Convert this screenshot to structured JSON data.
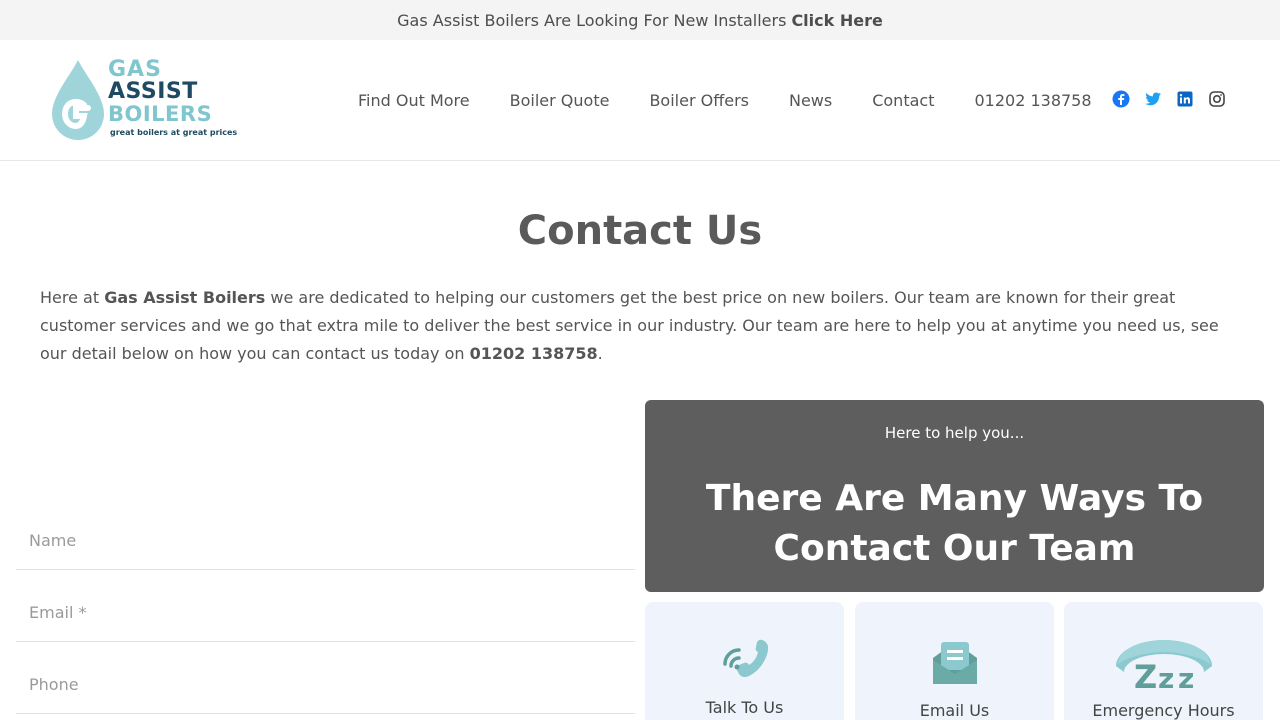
{
  "topbar": {
    "text": "Gas Assist Boilers Are Looking For New Installers",
    "link": "Click Here"
  },
  "logo": {
    "line1": "GAS",
    "line2": "ASSIST",
    "line3": "BOILERS",
    "tagline": "great boilers at great prices"
  },
  "nav": {
    "items": [
      {
        "label": "Find Out More"
      },
      {
        "label": "Boiler Quote"
      },
      {
        "label": "Boiler Offers"
      },
      {
        "label": "News"
      },
      {
        "label": "Contact"
      },
      {
        "label": "01202 138758"
      }
    ],
    "social": [
      "facebook-icon",
      "twitter-icon",
      "linkedin-icon",
      "instagram-icon"
    ]
  },
  "page": {
    "title": "Contact Us",
    "intro_before": "Here at ",
    "intro_brand": "Gas Assist Boilers",
    "intro_middle": " we are dedicated to helping our customers get the best price on new boilers. Our team are known for their great customer services and we go that extra mile to deliver the best service in our industry. Our team are here to help you at anytime you need us, see our detail below on how you can contact us today on ",
    "intro_phone": "01202 138758",
    "intro_end": "."
  },
  "form": {
    "name_placeholder": "Name",
    "email_placeholder": "Email *",
    "phone_placeholder": "Phone"
  },
  "help": {
    "kicker": "Here to help you...",
    "heading": "There Are Many Ways To Contact Our Team"
  },
  "cards": [
    {
      "label": "Talk To Us",
      "icon": "phone-icon"
    },
    {
      "label": "Email Us",
      "icon": "envelope-icon"
    },
    {
      "label": "Emergency Hours",
      "icon": "sleep-zzz-icon"
    }
  ],
  "colors": {
    "accent": "#7fc6ce",
    "brand_dark": "#1e4a63",
    "panel": "#5e5e5e",
    "card_bg": "#eef3fc"
  }
}
